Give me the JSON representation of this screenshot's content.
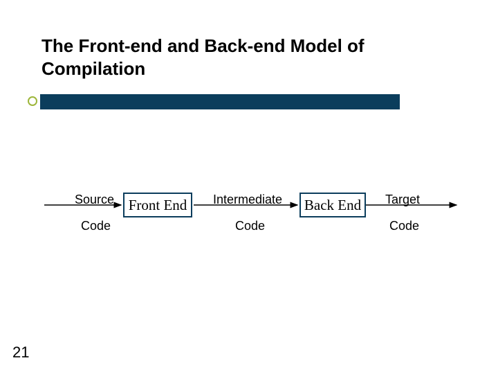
{
  "slide": {
    "title_line1": "The Front-end and Back-end Model of",
    "title_line2": "Compilation",
    "page_number": "21"
  },
  "labels": {
    "source": "Source",
    "code1": "Code",
    "intermediate": "Intermediate",
    "code2": "Code",
    "target": "Target",
    "code3": "Code"
  },
  "boxes": {
    "front_end": "Front End",
    "back_end": "Back End"
  }
}
